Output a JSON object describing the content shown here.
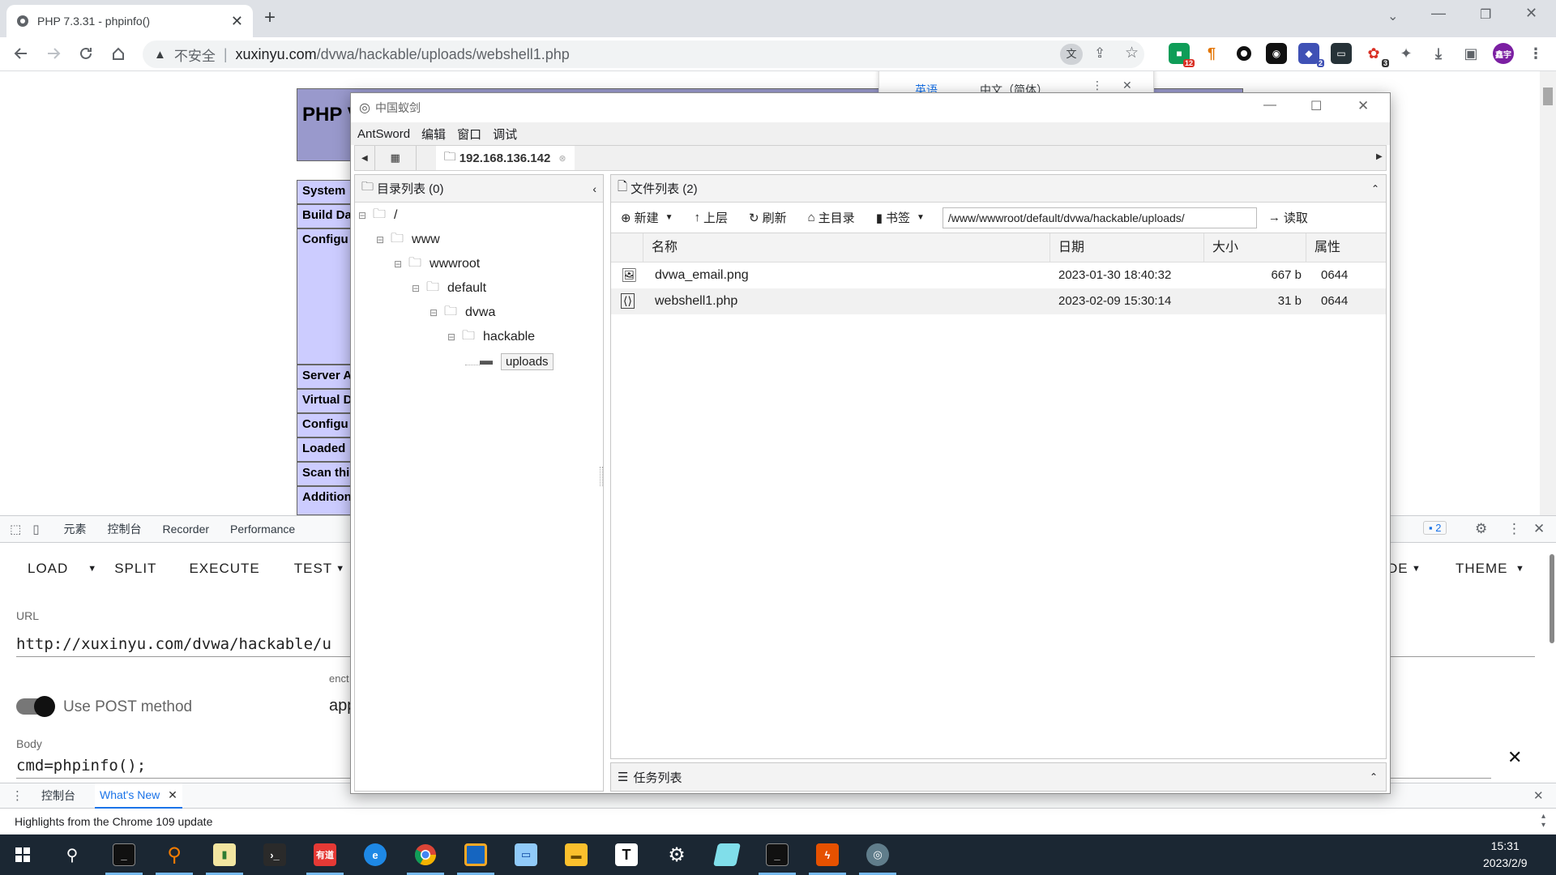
{
  "browser": {
    "tab_title": "PHP 7.3.31 - phpinfo()",
    "security_label": "不安全",
    "url_host": "xuxinyu.com",
    "url_path": "/dvwa/hackable/uploads/webshell1.php",
    "profile_label": "鑫宇",
    "ext_badges": [
      "12",
      "2",
      "3"
    ]
  },
  "translate_popup": {
    "lang_from": "英语",
    "lang_to": "中文（简体）"
  },
  "php_page": {
    "header": "PHP V",
    "rows": [
      "System",
      "Build Da",
      "Configu",
      "Server A",
      "Virtual D",
      "Configu",
      "Loaded",
      "Scan thi",
      "Addition"
    ]
  },
  "devtools": {
    "tabs": [
      "元素",
      "控制台",
      "Recorder",
      "Performance"
    ],
    "issues_count": "2",
    "drawer_tabs": [
      "控制台",
      "What's New"
    ],
    "highlights": "Highlights from the Chrome 109 update"
  },
  "hackbar": {
    "buttons": [
      "LOAD",
      "SPLIT",
      "EXECUTE",
      "TEST"
    ],
    "mode_label": "DE",
    "theme_label": "THEME",
    "url_label": "URL",
    "url_value": "http://xuxinyu.com/dvwa/hackable/u",
    "post_label": "Use POST method",
    "enctype_label": "enct",
    "enctype_value": "app",
    "body_label": "Body",
    "body_value": "cmd=phpinfo();"
  },
  "antsword": {
    "window_title": "中国蚁剑",
    "menu": [
      "AntSword",
      "编辑",
      "窗口",
      "调试"
    ],
    "tab_label": "192.168.136.142",
    "dir_header": "目录列表 (0)",
    "tree": [
      {
        "label": "/",
        "level": 0
      },
      {
        "label": "www",
        "level": 1
      },
      {
        "label": "wwwroot",
        "level": 2
      },
      {
        "label": "default",
        "level": 3
      },
      {
        "label": "dvwa",
        "level": 4
      },
      {
        "label": "hackable",
        "level": 5
      },
      {
        "label": "uploads",
        "level": 6
      }
    ],
    "file_header": "文件列表 (2)",
    "toolbar": {
      "new": "新建",
      "up": "上层",
      "refresh": "刷新",
      "home": "主目录",
      "bookmark": "书签",
      "read": "读取"
    },
    "path_value": "/www/wwwroot/default/dvwa/hackable/uploads/",
    "columns": [
      "名称",
      "日期",
      "大小",
      "属性"
    ],
    "files": [
      {
        "name": "dvwa_email.png",
        "date": "2023-01-30 18:40:32",
        "size": "667 b",
        "attr": "0644",
        "type": "image"
      },
      {
        "name": "webshell1.php",
        "date": "2023-02-09 15:30:14",
        "size": "31 b",
        "attr": "0644",
        "type": "code"
      }
    ],
    "task_header": "任务列表"
  },
  "taskbar": {
    "time": "15:31",
    "date": "2023/2/9",
    "youdao_label": "有道",
    "typora_label": "T"
  }
}
